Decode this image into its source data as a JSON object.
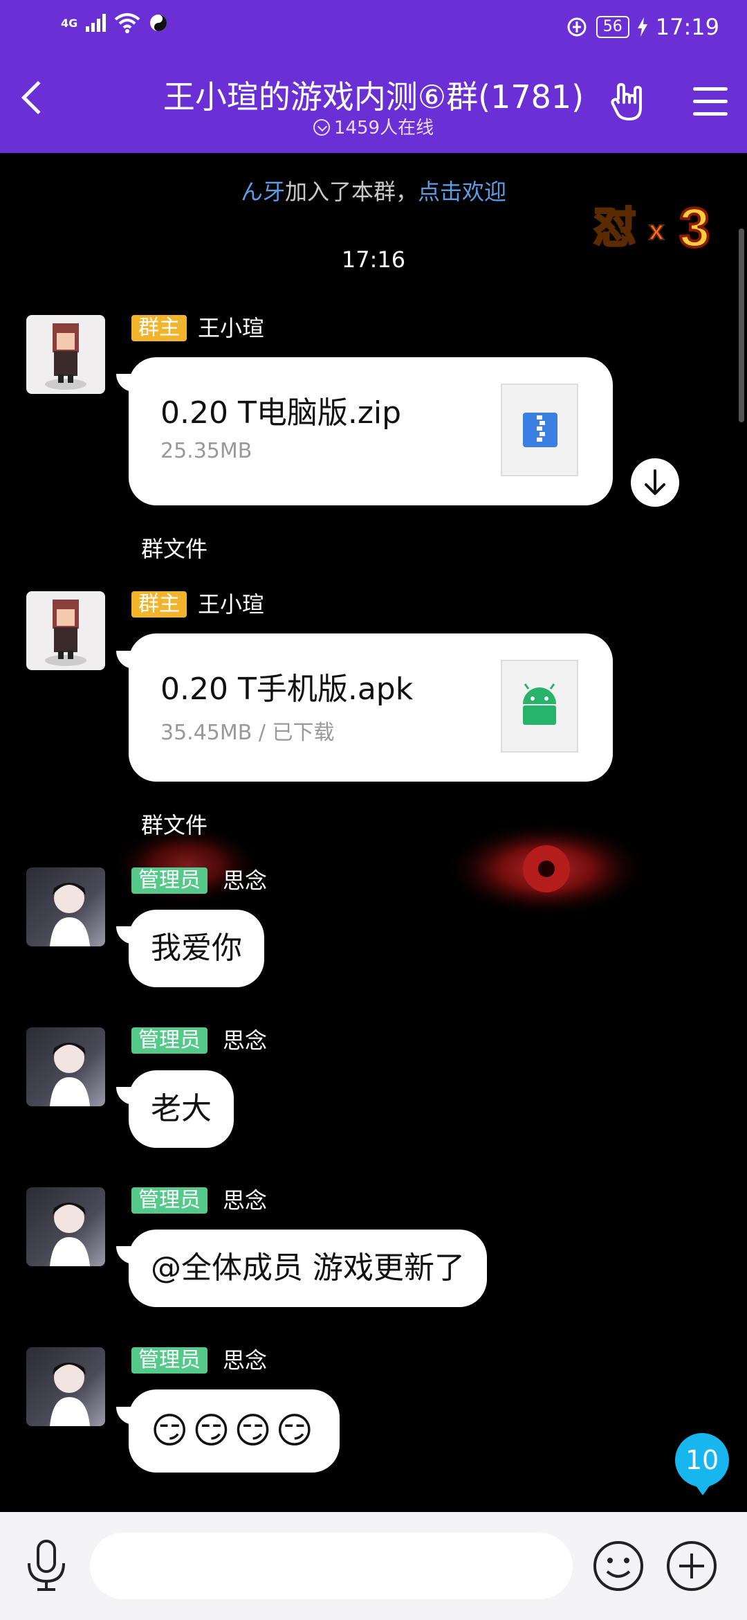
{
  "status_bar": {
    "network": "4G",
    "battery": "56",
    "time": "17:19"
  },
  "header": {
    "title": "王小瑄的游戏内测⑥群(1781)",
    "online": "1459人在线"
  },
  "system_notice": {
    "user": "ん牙",
    "action": "加入了本群，",
    "link": "点击欢迎"
  },
  "timestamp": "17:16",
  "sticker_text": "怼 x 3",
  "messages": [
    {
      "badge": "群主",
      "nick": "王小瑄",
      "type": "file",
      "file_name": "0.20 T电脑版.zip",
      "file_size": "25.35MB",
      "file_label": "群文件"
    },
    {
      "badge": "群主",
      "nick": "王小瑄",
      "type": "file",
      "file_name": "0.20 T手机版.apk",
      "file_size": "35.45MB / 已下载",
      "file_label": "群文件"
    },
    {
      "badge": "管理员",
      "nick": "思念",
      "type": "text",
      "text": "我爱你"
    },
    {
      "badge": "管理员",
      "nick": "思念",
      "type": "text",
      "text": "老大"
    },
    {
      "badge": "管理员",
      "nick": "思念",
      "type": "text",
      "text": "@全体成员 游戏更新了"
    },
    {
      "badge": "管理员",
      "nick": "思念",
      "type": "emoji",
      "text": "😏😏😏😏"
    }
  ],
  "unread_count": "10",
  "input": {
    "placeholder": ""
  },
  "colors": {
    "header": "#6a30d6",
    "owner_badge": "#f1b42c",
    "admin_badge": "#55c98a",
    "unread": "#17b6ee",
    "link": "#5a9ee6"
  }
}
